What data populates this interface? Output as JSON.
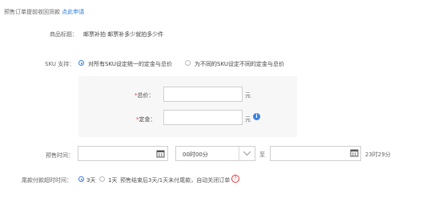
{
  "header": {
    "text": "预售订单提前收回货款",
    "link": "点此申请"
  },
  "goods": {
    "label": "商品标题：",
    "value": "邮票补拍 邮票补多少就拍多少件"
  },
  "sku": {
    "label": "SKU 支持：",
    "option1": "对所有SKU设定统一的定金与总价",
    "option2": "为不同的SKU设定不同的定金与总价",
    "selected": "option1"
  },
  "price": {
    "total_label": "总价：",
    "total_value": "",
    "total_unit": "元",
    "deposit_label": "定金：",
    "deposit_value": "",
    "deposit_unit": "元"
  },
  "presale_time": {
    "label": "预售时间：",
    "start_date": "",
    "start_time": "00时00分",
    "to_text": "至",
    "end_date": "",
    "end_time_text": "23时29分"
  },
  "final_payment": {
    "label": "尾款付款超时时间：",
    "opt_3": "3天",
    "opt_1": "1天",
    "note": "预售结束后3天/1天未付尾款，自动关闭订单",
    "selected": "3天"
  },
  "colors": {
    "link": "#2b7bd6",
    "accent": "#3b7fdc",
    "required": "#e4393c",
    "panel": "#f7f7f7"
  }
}
